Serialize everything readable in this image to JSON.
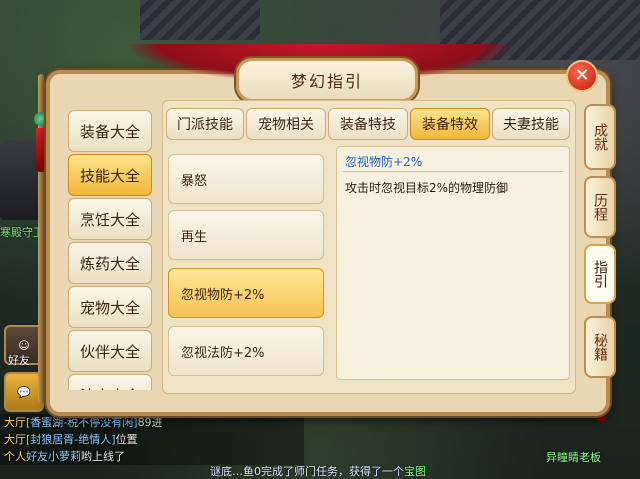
{
  "window": {
    "title": "梦幻指引"
  },
  "categories": [
    "装备大全",
    "技能大全",
    "烹饪大全",
    "炼药大全",
    "宠物大全",
    "伙伴大全",
    "法宝大全"
  ],
  "active_category": "技能大全",
  "tabs": [
    "门派技能",
    "宠物相关",
    "装备特技",
    "装备特效",
    "夫妻技能"
  ],
  "active_tab": "装备特效",
  "items": [
    "暴怒",
    "再生",
    "忽视物防+2%",
    "忽视法防+2%"
  ],
  "active_item": "忽视物防+2%",
  "detail": {
    "title": "忽视物防+2%",
    "description": "攻击时忽视目标2%的物理防御"
  },
  "side_tabs": [
    "成就",
    "历程",
    "指引",
    "秘籍"
  ],
  "active_side_tab": "指引",
  "hud": {
    "npc_name": "寒殿守卫",
    "friends_label": "好友"
  },
  "chat": [
    {
      "channel": "大厅",
      "name": "[香蜜湖-税不停没有闲]",
      "text": "89进"
    },
    {
      "channel": "大厅",
      "name": "[封狼居胥-绝情人]",
      "text": "位置"
    },
    {
      "channel": "个人",
      "name": "好友小萝莉",
      "text": "哟上线了"
    }
  ],
  "bottom_message": {
    "prefix": "谜底…鱼0完成了师门任务，获得了一个",
    "highlight": "宝图"
  },
  "corner_notice": "异瞳睛老板",
  "icons": {
    "close": "close-icon",
    "chat": "chat-bubble-icon"
  },
  "colors": {
    "active_gold": "#f0b73a",
    "detail_title_blue": "#1c64c8",
    "curtain_red": "#c8182a"
  }
}
